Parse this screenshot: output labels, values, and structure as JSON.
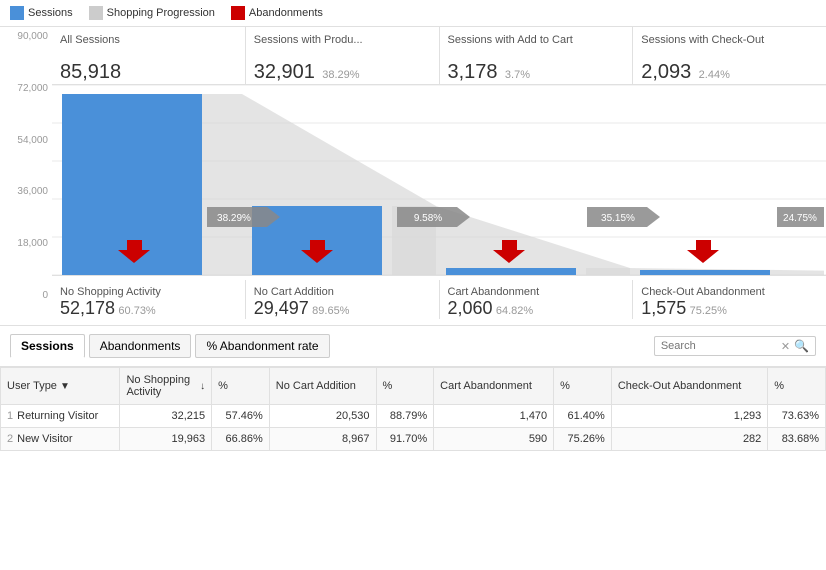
{
  "legend": {
    "items": [
      {
        "label": "Sessions",
        "color": "#4a90d9",
        "type": "square"
      },
      {
        "label": "Shopping Progression",
        "color": "#cccccc",
        "type": "square"
      },
      {
        "label": "Abandonments",
        "color": "#cc0000",
        "type": "square"
      }
    ]
  },
  "funnel": {
    "columns": [
      {
        "title": "All Sessions",
        "value": "85,918",
        "pct": "",
        "arrow_pct": "38.29%"
      },
      {
        "title": "Sessions with Produ...",
        "value": "32,901",
        "pct": "38.29%",
        "arrow_pct": "9.58%"
      },
      {
        "title": "Sessions with Add to Cart",
        "value": "3,178",
        "pct": "3.7%",
        "arrow_pct": "35.15%"
      },
      {
        "title": "Sessions with Check-Out",
        "value": "2,093",
        "pct": "2.44%",
        "arrow_pct": "24.75%"
      }
    ],
    "abandonment_rows": [
      {
        "label": "No Shopping Activity",
        "value": "52,178",
        "pct": "60.73%"
      },
      {
        "label": "No Cart Addition",
        "value": "29,497",
        "pct": "89.65%"
      },
      {
        "label": "Cart Abandonment",
        "value": "2,060",
        "pct": "64.82%"
      },
      {
        "label": "Check-Out Abandonment",
        "value": "1,575",
        "pct": "75.25%"
      }
    ],
    "y_labels": [
      "90,000",
      "72,000",
      "54,000",
      "36,000",
      "18,000",
      "0"
    ]
  },
  "tabs": {
    "items": [
      "Sessions",
      "Abandonments",
      "% Abandonment rate"
    ],
    "active": "Sessions"
  },
  "search": {
    "placeholder": "Search"
  },
  "table": {
    "headers": [
      {
        "label": "User Type",
        "sortable": true
      },
      {
        "label": "No Shopping Activity",
        "sortable": true
      },
      {
        "label": "%"
      },
      {
        "label": "No Cart Addition",
        "sortable": false
      },
      {
        "label": "%"
      },
      {
        "label": "Cart Abandonment",
        "sortable": false
      },
      {
        "label": "%"
      },
      {
        "label": "Check-Out Abandonment",
        "sortable": false
      },
      {
        "label": "%"
      }
    ],
    "rows": [
      {
        "num": "1",
        "type": "Returning Visitor",
        "v1": "32,215",
        "p1": "57.46%",
        "v2": "20,530",
        "p2": "88.79%",
        "v3": "1,470",
        "p3": "61.40%",
        "v4": "1,293",
        "p4": "73.63%"
      },
      {
        "num": "2",
        "type": "New Visitor",
        "v1": "19,963",
        "p1": "66.86%",
        "v2": "8,967",
        "p2": "91.70%",
        "v3": "590",
        "p3": "75.26%",
        "v4": "282",
        "p4": "83.68%"
      }
    ]
  }
}
